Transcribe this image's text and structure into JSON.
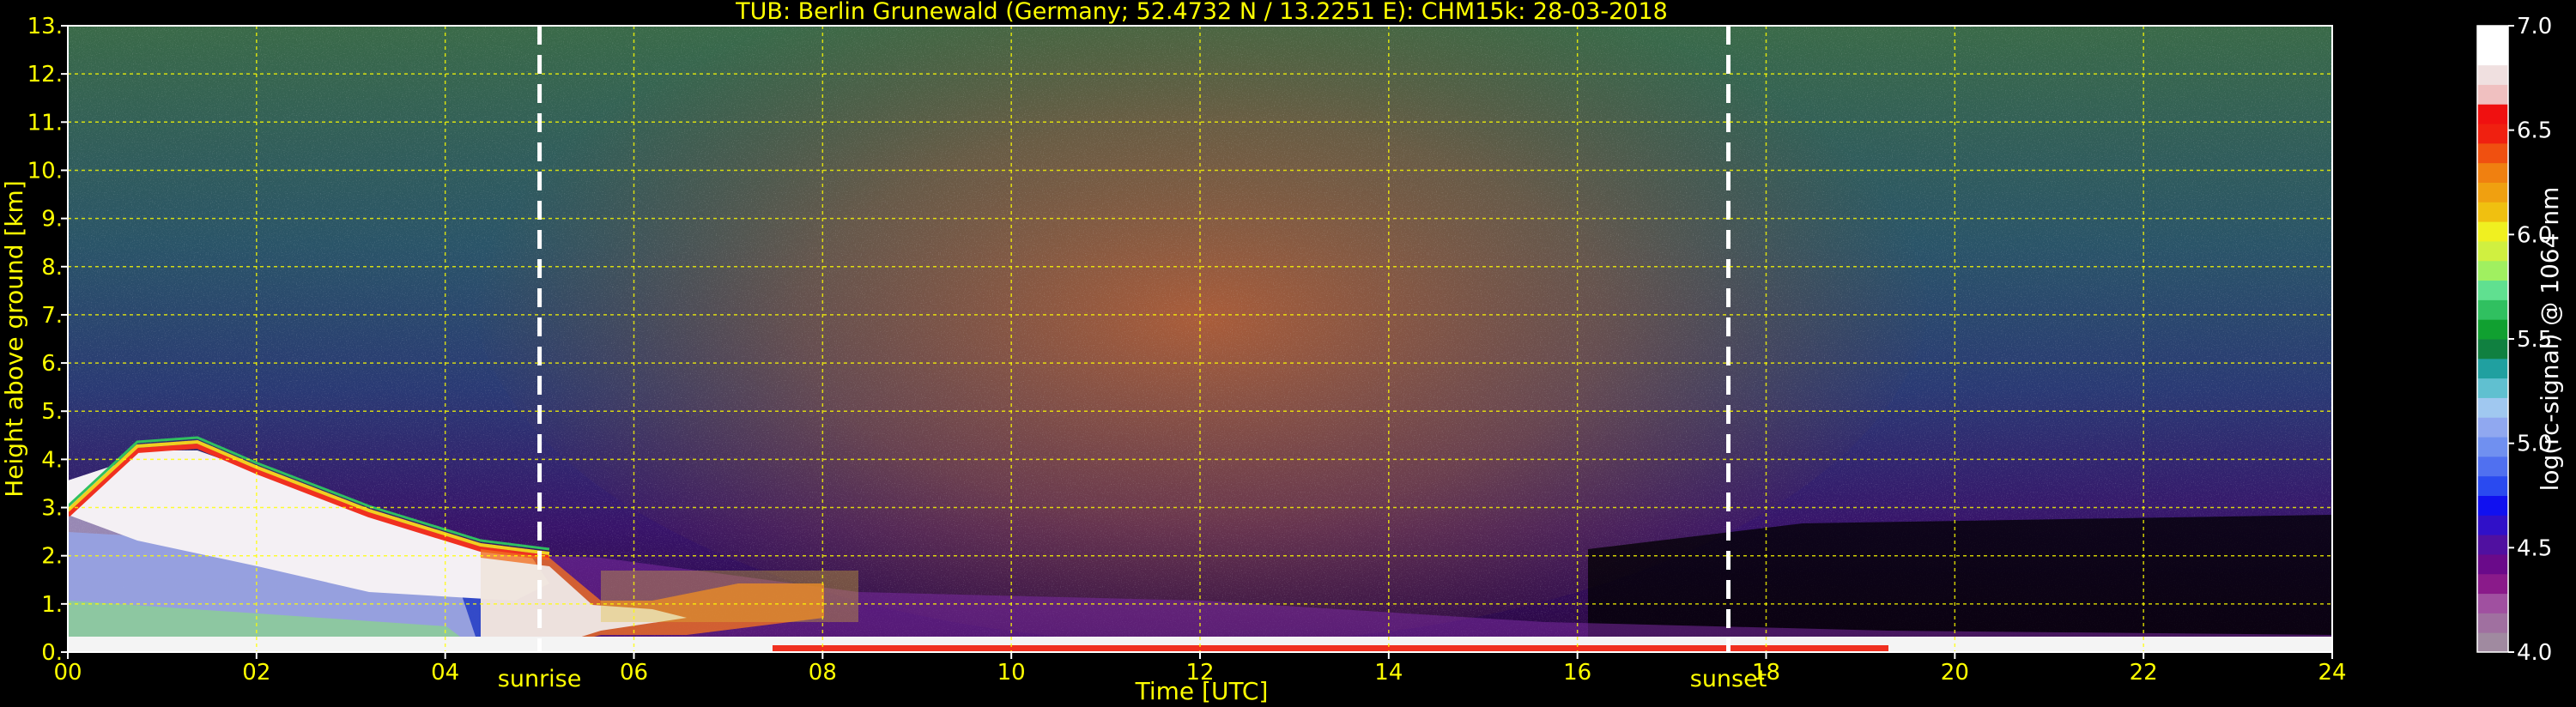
{
  "chart_data": {
    "type": "heatmap",
    "title": "TUB: Berlin Grunewald (Germany; 52.4732 N / 13.2251 E):    CHM15k: 28-03-2018",
    "xlabel": "Time [UTC]",
    "ylabel": "Height above ground [km]",
    "x_ticks": [
      "00",
      "02",
      "04",
      "06",
      "08",
      "10",
      "12",
      "14",
      "16",
      "18",
      "20",
      "22",
      "24"
    ],
    "y_ticks": [
      "0.",
      "1.",
      "2.",
      "3.",
      "4.",
      "5.",
      "6.",
      "7.",
      "8.",
      "9.",
      "10.",
      "11.",
      "12.",
      "13."
    ],
    "xlim": [
      0,
      24
    ],
    "ylim": [
      0,
      13
    ],
    "grid": true,
    "annotations": [
      {
        "label": "sunrise",
        "x": 5.0
      },
      {
        "label": "sunset",
        "x": 17.6
      }
    ],
    "colorbar": {
      "label": "log(rc-signal) @ 1064 nm",
      "ticks": [
        "4.0",
        "4.5",
        "5.0",
        "5.5",
        "6.0",
        "6.5",
        "7.0"
      ],
      "range": [
        4.0,
        7.0
      ],
      "colors": [
        "#a08aa0",
        "#a070a0",
        "#a050a0",
        "#8a1a8a",
        "#6a0a8a",
        "#5010a0",
        "#3010c8",
        "#1010f0",
        "#2a4af0",
        "#5070f0",
        "#7090f0",
        "#90a8f0",
        "#a0c8f0",
        "#60c0d0",
        "#20a0a0",
        "#108040",
        "#10a030",
        "#30c060",
        "#60e090",
        "#a0f060",
        "#d0f040",
        "#f0f020",
        "#f0c010",
        "#f0a010",
        "#f08010",
        "#f05010",
        "#f02010",
        "#f01010",
        "#f0c0c0",
        "#f0e0e0",
        "#ffffff",
        "#ffffff"
      ]
    }
  },
  "colors": {
    "axis_text": "#ffff00",
    "grid": "#ffff00",
    "frame": "#ffffff",
    "background": "#000000"
  }
}
